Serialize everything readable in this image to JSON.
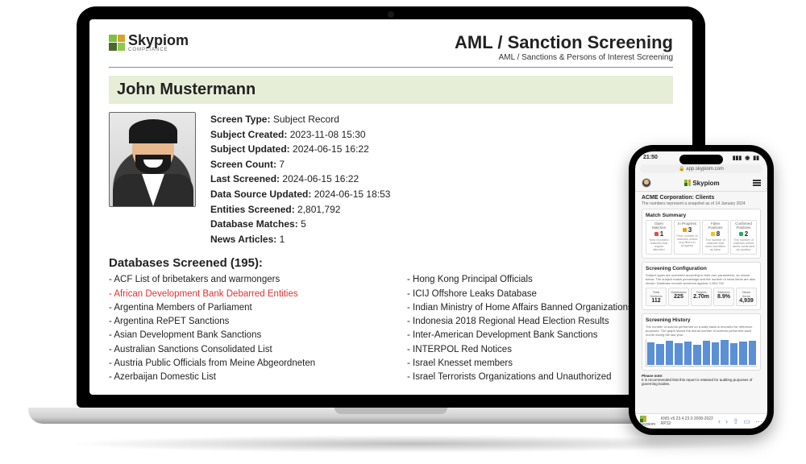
{
  "brand": {
    "name": "Skypiom",
    "subtitle": "COMPLIANCE"
  },
  "doc": {
    "title": "AML / Sanction Screening",
    "subtitle": "AML / Sanctions & Persons of Interest Screening",
    "subject_name": "John Mustermann",
    "meta": {
      "screen_type_label": "Screen Type:",
      "screen_type": "Subject Record",
      "created_label": "Subject Created:",
      "created": "2023-11-08 15:30",
      "updated_label": "Subject Updated:",
      "updated": "2024-06-15 16:22",
      "count_label": "Screen Count:",
      "count": "7",
      "last_label": "Last Screened:",
      "last": "2024-06-15 16:22",
      "datasource_label": "Data Source Updated:",
      "datasource": "2024-06-15 18:53",
      "entities_label": "Entities Screened:",
      "entities": "2,801,792",
      "matches_label": "Database Matches:",
      "matches": "5",
      "news_label": "News Articles:",
      "news": "1"
    },
    "db_heading": "Databases Screened (195):",
    "db_left": [
      {
        "t": "- ACF List of bribetakers and warmongers",
        "red": false
      },
      {
        "t": "- African Development Bank Debarred Entities",
        "red": true
      },
      {
        "t": "- Argentina Members of Parliament",
        "red": false
      },
      {
        "t": "- Argentina RePET Sanctions",
        "red": false
      },
      {
        "t": "- Asian Development Bank Sanctions",
        "red": false
      },
      {
        "t": "- Australian Sanctions Consolidated List",
        "red": false
      },
      {
        "t": "- Austria Public Officials from Meine Abgeordneten",
        "red": false
      },
      {
        "t": "- Azerbaijan Domestic List",
        "red": false
      }
    ],
    "db_right": [
      {
        "t": "- Hong Kong Principal Officials",
        "red": false
      },
      {
        "t": "- ICIJ Offshore Leaks Database",
        "red": false
      },
      {
        "t": "- Indian Ministry of Home Affairs Banned Organizations",
        "red": false
      },
      {
        "t": "- Indonesia 2018 Regional Head Election Results",
        "red": false
      },
      {
        "t": "- Inter-American Development Bank Sanctions",
        "red": false
      },
      {
        "t": "- INTERPOL Red Notices",
        "red": false
      },
      {
        "t": "- Israel Knesset members",
        "red": false
      },
      {
        "t": "- Israel Terrorists Organizations and Unauthorized",
        "red": false
      }
    ]
  },
  "phone": {
    "time": "21:50",
    "url": "app.skypiom.com",
    "page_title": "ACME Corporation: Clients",
    "page_sub": "The numbers represent a snapshot as of 14 January 2024",
    "match_summary_title": "Match Summary",
    "matches": [
      {
        "color": "red",
        "label": "Open Matches",
        "value": "1",
        "desc": "New recorded matches that require attention"
      },
      {
        "color": "orange",
        "label": "In Progress",
        "value": "3",
        "desc": "Prior number of matches where any filters in progress"
      },
      {
        "color": "yellow",
        "label": "False Positives",
        "value": "8",
        "desc": "The number of matches that were identified as false"
      },
      {
        "color": "green",
        "label": "Confirmed Positives",
        "value": "2",
        "desc": "The number of matches where alerts confirmed as positive"
      }
    ],
    "config_title": "Screening Configuration",
    "config_sub": "Subject types are screened according to their own parameters, as shown below. The subject match percentage and the number of news items are also shown. Database records screened against: 2,801,792",
    "config": [
      {
        "v": "112",
        "l": "Total Subjects"
      },
      {
        "v": "225",
        "l": "Databases"
      },
      {
        "v": "2.70m",
        "l": "Targets"
      },
      {
        "v": "8.9%",
        "l": "Matches"
      },
      {
        "v": "4,939",
        "l": "News Items"
      }
    ],
    "history_title": "Screening History",
    "history_sub": "The number of actions performed on a daily basis is recorded for reference purposes. The graph shows the actual number of screens performed each month during the last year.",
    "history_bars": [
      28,
      26,
      30,
      27,
      29,
      25,
      30,
      28,
      31,
      27,
      29,
      30
    ],
    "footer_note": "Please note:",
    "footer_text": "It is recommended that this report is retained for auditing purposes of governing bodies.",
    "footer_brand": "Skypiom",
    "footer_meta": "KMS v5.23.4.23.0 2008-2022 RP32"
  }
}
